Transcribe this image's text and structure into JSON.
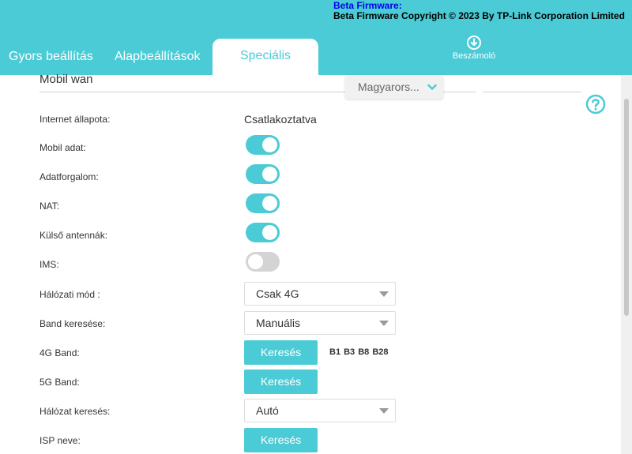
{
  "header": {
    "beta_title": "Beta Firmware:",
    "beta_copyright": "Beta Firmware Copyright © 2023 By TP-Link Corporation Limited",
    "tabs": [
      "Gyors beállítás",
      "Alapbeállítások",
      "Speciális"
    ],
    "active_tab": "Speciális",
    "report_label": "Beszámoló",
    "report_icon": "download-circle-icon"
  },
  "section": {
    "title": "Mobil wan",
    "language": "Magyarors...",
    "help_icon": "help-circle-icon"
  },
  "rows": {
    "internet_status": {
      "label": "Internet állapota:",
      "value": "Csatlakoztatva"
    },
    "mobile_data": {
      "label": "Mobil adat:",
      "enabled": true
    },
    "data_traffic": {
      "label": "Adatforgalom:",
      "enabled": true
    },
    "nat": {
      "label": "NAT:",
      "enabled": true
    },
    "external_antennas": {
      "label": "Külső antennák:",
      "enabled": true
    },
    "ims": {
      "label": "IMS:",
      "enabled": false
    },
    "network_mode": {
      "label": "Hálózati mód :",
      "selected": "Csak 4G"
    },
    "band_search": {
      "label": "Band keresése:",
      "selected": "Manuális"
    },
    "band_4g": {
      "label": "4G Band:",
      "button": "Keresés",
      "bands": "B1 B3 B8 B28"
    },
    "band_5g": {
      "label": "5G Band:",
      "button": "Keresés"
    },
    "network_search": {
      "label": "Hálózat keresés:",
      "selected": "Autó"
    },
    "isp_name": {
      "label": "ISP neve:",
      "button": "Keresés"
    }
  },
  "colors": {
    "accent": "#4acbd6",
    "toggle_off": "#d4d4d4",
    "beta_link": "#0000ee"
  }
}
